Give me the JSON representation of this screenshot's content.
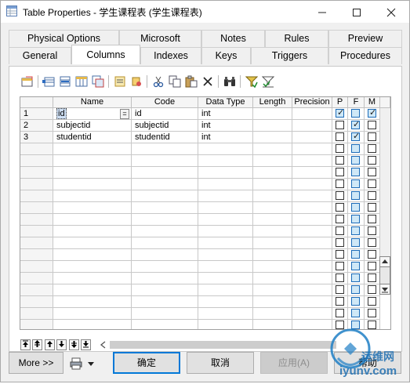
{
  "window": {
    "title": "Table Properties - 学生课程表 (学生课程表)",
    "min_icon": "minimize-icon",
    "max_icon": "maximize-icon",
    "close_icon": "close-icon"
  },
  "tabs_row1": [
    "Physical Options",
    "Microsoft",
    "Notes",
    "Rules",
    "Preview"
  ],
  "tabs_row2": [
    "General",
    "Columns",
    "Indexes",
    "Keys",
    "Triggers",
    "Procedures"
  ],
  "active_tab": "Columns",
  "grid": {
    "headers": [
      "Name",
      "Code",
      "Data Type",
      "Length",
      "Precision",
      "P",
      "F",
      "M"
    ],
    "rows": [
      {
        "num": "1",
        "name": "id",
        "code": "id",
        "type": "int",
        "length": "",
        "precision": "",
        "p": true,
        "f": false,
        "m": true
      },
      {
        "num": "2",
        "name": "subjectid",
        "code": "subjectid",
        "type": "int",
        "length": "",
        "precision": "",
        "p": false,
        "f": true,
        "m": false
      },
      {
        "num": "3",
        "name": "studentid",
        "code": "studentid",
        "type": "int",
        "length": "",
        "precision": "",
        "p": false,
        "f": true,
        "m": false
      }
    ],
    "name_cell_suffix": "="
  },
  "buttons": {
    "more": "More >>",
    "ok": "确定",
    "cancel": "取消",
    "apply": "应用(A)",
    "help": "帮助"
  },
  "watermark": {
    "line1": "运维网",
    "line2": "iyunv.com"
  },
  "colors": {
    "accent": "#0078d7",
    "check_blue": "#1c6bb8"
  }
}
